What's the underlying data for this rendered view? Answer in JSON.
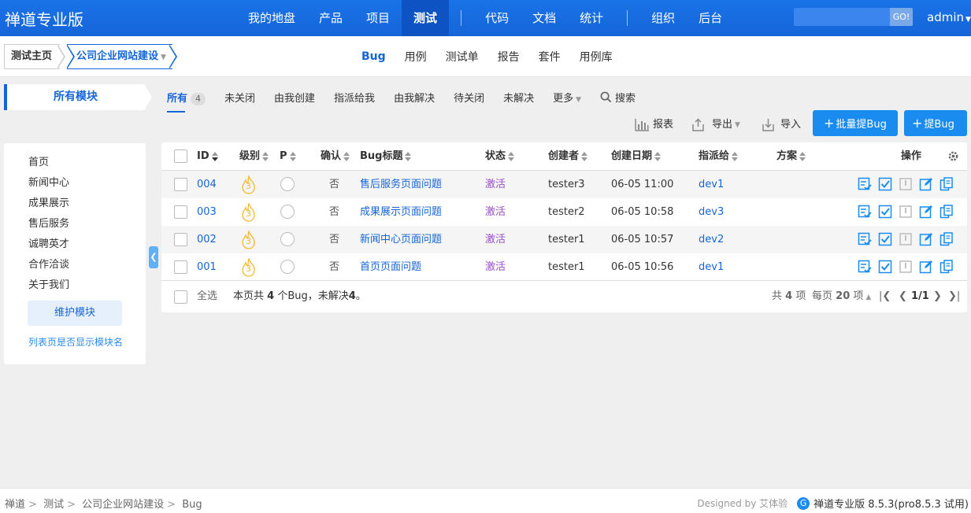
{
  "brand": "禅道专业版",
  "main_nav": [
    {
      "label": "我的地盘"
    },
    {
      "label": "产品"
    },
    {
      "label": "项目"
    },
    {
      "label": "测试",
      "active": true
    },
    {
      "label": "代码"
    },
    {
      "label": "文档"
    },
    {
      "label": "统计"
    },
    {
      "label": "组织"
    },
    {
      "label": "后台"
    }
  ],
  "search": {
    "go_label": "GO!",
    "placeholder": ""
  },
  "user": {
    "name": "admin"
  },
  "subbar": {
    "home_label": "测试主页",
    "product_label": "公司企业网站建设",
    "tabs": [
      "Bug",
      "用例",
      "测试单",
      "报告",
      "套件",
      "用例库"
    ],
    "active_tab": "Bug"
  },
  "module": {
    "all_label": "所有模块"
  },
  "filters": {
    "items": [
      "所有",
      "未关闭",
      "由我创建",
      "指派给我",
      "由我解决",
      "待关闭",
      "未解决",
      "更多"
    ],
    "all_count": "4",
    "search_label": "搜索"
  },
  "actions": {
    "report": "报表",
    "export": "导出",
    "import": "导入",
    "batch_create": "批量提Bug",
    "create": "提Bug"
  },
  "tree": {
    "items": [
      "首页",
      "新闻中心",
      "成果展示",
      "售后服务",
      "诚聘英才",
      "合作洽谈",
      "关于我们"
    ],
    "maintain_label": "维护模块",
    "show_module_link": "列表页是否显示模块名"
  },
  "table": {
    "columns": {
      "id": "ID",
      "severity": "级别",
      "pri": "P",
      "confirmed": "确认",
      "title": "Bug标题",
      "status": "状态",
      "creator": "创建者",
      "created": "创建日期",
      "assigned": "指派给",
      "resolution": "方案",
      "actions": "操作"
    },
    "rows": [
      {
        "id": "004",
        "severity": "3",
        "confirmed": "否",
        "title": "售后服务页面问题",
        "status": "激活",
        "creator": "tester3",
        "created": "06-05 11:00",
        "assigned": "dev1"
      },
      {
        "id": "003",
        "severity": "3",
        "confirmed": "否",
        "title": "成果展示页面问题",
        "status": "激活",
        "creator": "tester2",
        "created": "06-05 10:58",
        "assigned": "dev3"
      },
      {
        "id": "002",
        "severity": "3",
        "confirmed": "否",
        "title": "新闻中心页面问题",
        "status": "激活",
        "creator": "tester1",
        "created": "06-05 10:57",
        "assigned": "dev2"
      },
      {
        "id": "001",
        "severity": "3",
        "confirmed": "否",
        "title": "首页页面问题",
        "status": "激活",
        "creator": "tester1",
        "created": "06-05 10:56",
        "assigned": "dev1"
      }
    ],
    "footer": {
      "select_all": "全选",
      "summary_pre": "本页共",
      "summary_count": "4",
      "summary_mid": "个Bug，未解决",
      "summary_unresolved": "4",
      "summary_end": "。",
      "total_pre": "共",
      "total_count": "4",
      "total_suf": "项",
      "per_page_pre": "每页",
      "per_page": "20",
      "per_page_suf": "项",
      "page": "1/1"
    }
  },
  "bottom": {
    "breadcrumb": [
      "禅道",
      "测试",
      "公司企业网站建设",
      "Bug"
    ],
    "designed_by_pre": "Designed by",
    "designed_by": "艾体验",
    "version": "禅道专业版 8.5.3(pro8.5.3 试用)"
  },
  "colors": {
    "primary": "#1565d8",
    "header": "#1a73e8",
    "button": "#1a8cf0",
    "status_active": "#9b4dca",
    "severity": "#f5b82e"
  }
}
